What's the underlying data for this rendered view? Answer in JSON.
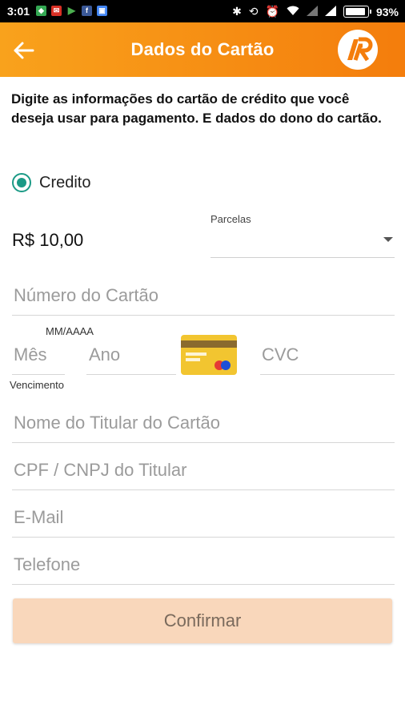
{
  "status_bar": {
    "time": "3:01",
    "battery_percent": "93%",
    "left_icons": [
      "maps-icon",
      "mail-icon",
      "play-store-icon",
      "facebook-icon",
      "photo-icon"
    ],
    "right_icons": [
      "bluetooth-icon",
      "rotate-icon",
      "alarm-icon",
      "wifi-icon",
      "signal-icon",
      "signal-icon"
    ]
  },
  "app_bar": {
    "title": "Dados do Cartão",
    "accent_start": "#f9a21c",
    "accent_end": "#f47d0c",
    "logo_text": "AR"
  },
  "intro_text": "Digite as informações do cartão de crédito que você deseja usar para pagamento. E dados do dono do cartão.",
  "payment_type": {
    "label": "Credito",
    "selected": true,
    "color": "#1b9a86"
  },
  "amount": "R$ 10,00",
  "installments": {
    "label": "Parcelas",
    "value": ""
  },
  "form": {
    "card_number_placeholder": "Número do Cartão",
    "expiry_format_label": "MM/AAAA",
    "month_placeholder": "Mês",
    "year_placeholder": "Ano",
    "cvc_placeholder": "CVC",
    "expiry_caption": "Vencimento",
    "holder_name_placeholder": "Nome do Titular do Cartão",
    "holder_doc_placeholder": "CPF / CNPJ do Titular",
    "email_placeholder": "E-Mail",
    "phone_placeholder": "Telefone"
  },
  "confirm_button": {
    "label": "Confirmar",
    "color": "#f9d7bb"
  }
}
